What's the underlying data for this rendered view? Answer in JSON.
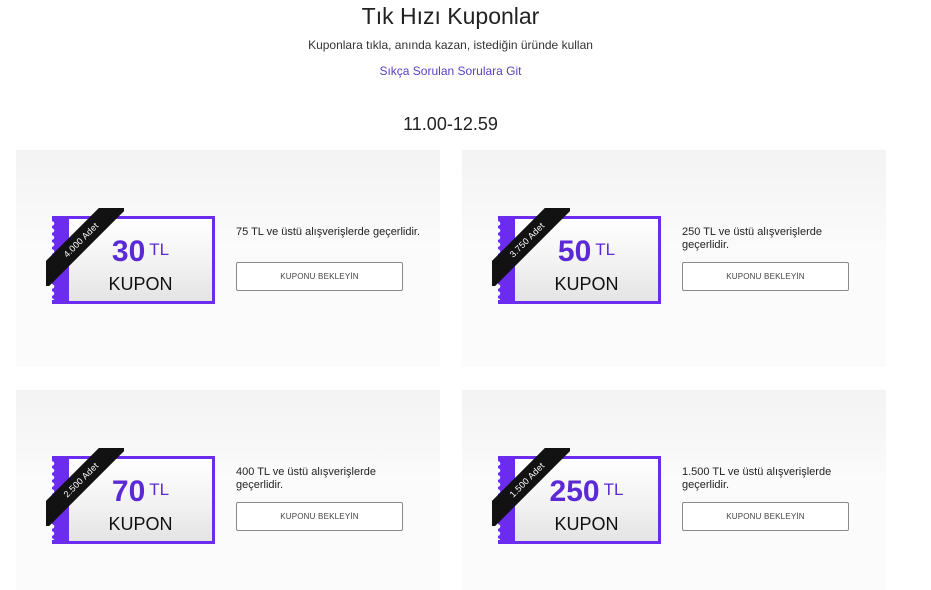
{
  "header": {
    "title": "Tık Hızı Kuponlar",
    "subtitle": "Kuponlara tıkla, anında kazan, istediğin üründe kullan",
    "faq_link": "Sıkça Sorulan Sorulara Git",
    "time_range": "11.00-12.59"
  },
  "colors": {
    "accent": "#6b2cf0",
    "amount_text": "#5b2ad6",
    "ribbon": "#121212",
    "link": "#5b3fc4"
  },
  "coupons": [
    {
      "quantity": "4.000 Adet",
      "amount": "30",
      "currency": "TL",
      "kupon_label": "KUPON",
      "condition": "75 TL ve üstü alışverişlerde geçerlidir.",
      "button_label": "KUPONU BEKLEYİN"
    },
    {
      "quantity": "3.750 Adet",
      "amount": "50",
      "currency": "TL",
      "kupon_label": "KUPON",
      "condition": "250 TL ve üstü alışverişlerde geçerlidir.",
      "button_label": "KUPONU BEKLEYİN"
    },
    {
      "quantity": "2.500 Adet",
      "amount": "70",
      "currency": "TL",
      "kupon_label": "KUPON",
      "condition": "400 TL ve üstü alışverişlerde geçerlidir.",
      "button_label": "KUPONU BEKLEYİN"
    },
    {
      "quantity": "1.500 Adet",
      "amount": "250",
      "currency": "TL",
      "kupon_label": "KUPON",
      "condition": "1.500 TL ve üstü alışverişlerde geçerlidir.",
      "button_label": "KUPONU BEKLEYİN"
    }
  ]
}
